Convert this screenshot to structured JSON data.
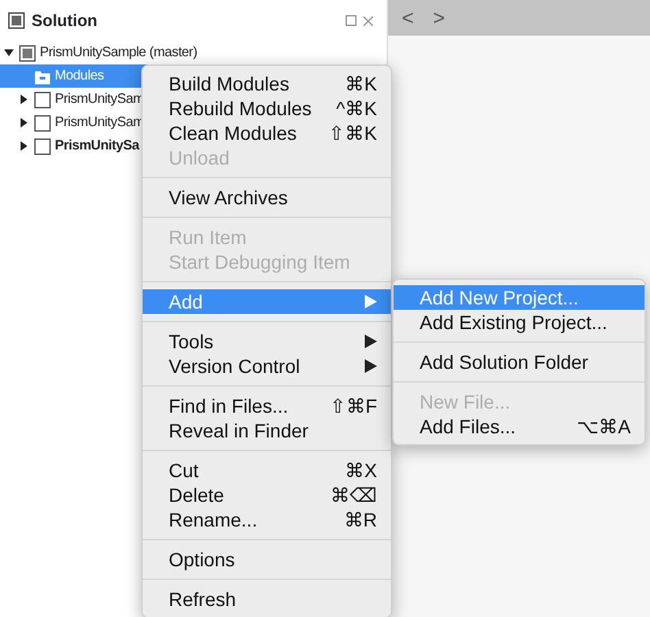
{
  "solution_panel": {
    "title": "Solution"
  },
  "tree": [
    {
      "label": "PrismUnitySample (master)",
      "kind": "solution",
      "expanded": true,
      "selected": false,
      "bold": false,
      "children": [
        {
          "label": "Modules",
          "kind": "folder",
          "selected": true,
          "bold": false
        },
        {
          "label": "PrismUnitySam",
          "kind": "project",
          "expanded": false,
          "selected": false,
          "bold": false
        },
        {
          "label": "PrismUnitySam",
          "kind": "project",
          "expanded": false,
          "selected": false,
          "bold": false
        },
        {
          "label": "PrismUnitySa",
          "kind": "project",
          "expanded": false,
          "selected": false,
          "bold": true
        }
      ]
    }
  ],
  "nav": {
    "back": "<",
    "forward": ">"
  },
  "context_menu": [
    {
      "kind": "item",
      "label": "Build Modules",
      "shortcut": "⌘K",
      "disabled": false,
      "selected": false,
      "submenu": false
    },
    {
      "kind": "item",
      "label": "Rebuild Modules",
      "shortcut": "^⌘K",
      "disabled": false,
      "selected": false,
      "submenu": false
    },
    {
      "kind": "item",
      "label": "Clean Modules",
      "shortcut": "⇧⌘K",
      "disabled": false,
      "selected": false,
      "submenu": false
    },
    {
      "kind": "item",
      "label": "Unload",
      "disabled": true,
      "selected": false,
      "submenu": false
    },
    {
      "kind": "separator"
    },
    {
      "kind": "item",
      "label": "View Archives",
      "disabled": false,
      "selected": false,
      "submenu": false
    },
    {
      "kind": "separator"
    },
    {
      "kind": "item",
      "label": "Run Item",
      "disabled": true,
      "selected": false,
      "submenu": false
    },
    {
      "kind": "item",
      "label": "Start Debugging Item",
      "disabled": true,
      "selected": false,
      "submenu": false
    },
    {
      "kind": "separator"
    },
    {
      "kind": "item",
      "label": "Add",
      "disabled": false,
      "selected": true,
      "submenu": true
    },
    {
      "kind": "separator"
    },
    {
      "kind": "item",
      "label": "Tools",
      "disabled": false,
      "selected": false,
      "submenu": true
    },
    {
      "kind": "item",
      "label": "Version Control",
      "disabled": false,
      "selected": false,
      "submenu": true
    },
    {
      "kind": "separator"
    },
    {
      "kind": "item",
      "label": "Find in Files...",
      "shortcut": "⇧⌘F",
      "disabled": false,
      "selected": false,
      "submenu": false
    },
    {
      "kind": "item",
      "label": "Reveal in Finder",
      "disabled": false,
      "selected": false,
      "submenu": false
    },
    {
      "kind": "separator"
    },
    {
      "kind": "item",
      "label": "Cut",
      "shortcut": "⌘X",
      "disabled": false,
      "selected": false,
      "submenu": false
    },
    {
      "kind": "item",
      "label": "Delete",
      "shortcut": "⌘⌫",
      "disabled": false,
      "selected": false,
      "submenu": false
    },
    {
      "kind": "item",
      "label": "Rename...",
      "shortcut": "⌘R",
      "disabled": false,
      "selected": false,
      "submenu": false
    },
    {
      "kind": "separator"
    },
    {
      "kind": "item",
      "label": "Options",
      "disabled": false,
      "selected": false,
      "submenu": false
    },
    {
      "kind": "separator"
    },
    {
      "kind": "item",
      "label": "Refresh",
      "disabled": false,
      "selected": false,
      "submenu": false
    }
  ],
  "submenu": [
    {
      "kind": "item",
      "label": "Add New Project...",
      "disabled": false,
      "selected": true
    },
    {
      "kind": "item",
      "label": "Add Existing Project...",
      "disabled": false,
      "selected": false
    },
    {
      "kind": "separator"
    },
    {
      "kind": "item",
      "label": "Add Solution Folder",
      "disabled": false,
      "selected": false
    },
    {
      "kind": "separator"
    },
    {
      "kind": "item",
      "label": "New File...",
      "disabled": true,
      "selected": false
    },
    {
      "kind": "item",
      "label": "Add Files...",
      "shortcut": "⌥⌘A",
      "disabled": false,
      "selected": false
    }
  ]
}
